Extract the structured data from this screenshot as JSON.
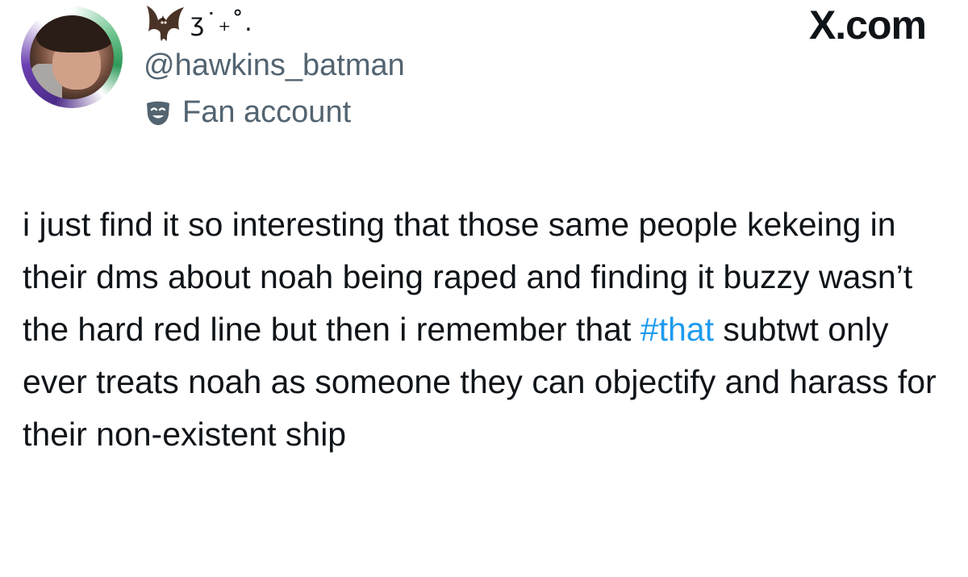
{
  "author": {
    "display_name_symbols": "ʒ˙₊˚.",
    "handle": "@hawkins_batman",
    "account_label": "Fan account",
    "label_icon": "theater-mask-icon",
    "name_icon": "bat-icon"
  },
  "brand": {
    "text": "X.com"
  },
  "tweet": {
    "text_before": "i just find it so interesting that those same people kekeing in their dms about noah being raped and finding it buzzy wasn’t the hard red line but then i remember that ",
    "hashtag": "#that",
    "text_after": " subtwt only ever treats noah as someone they can objectify and harass for their non-existent ship"
  },
  "colors": {
    "text": "#0f1419",
    "secondary": "#536471",
    "link": "#1d9bf0",
    "avatar_ring_purple": "#4b2a88",
    "avatar_ring_green": "#2f9a5a"
  }
}
